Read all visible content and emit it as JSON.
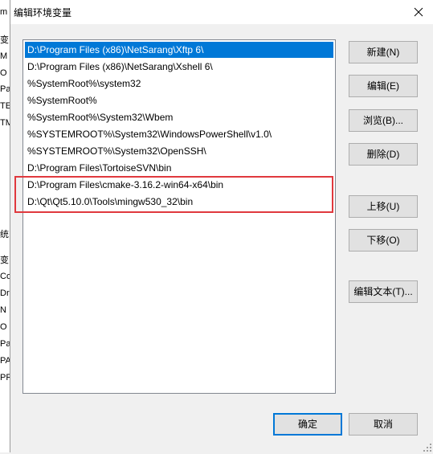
{
  "background_window": {
    "edge_chars": [
      "m",
      "变",
      "M",
      "O",
      "Pa",
      "TE",
      "TM",
      "统",
      "变",
      "Co",
      "Dr",
      "N",
      "O",
      "Pa",
      "PA",
      "PR"
    ]
  },
  "dialog": {
    "title": "编辑环境变量",
    "close_icon": "close-icon"
  },
  "list": {
    "items": [
      "D:\\Program Files (x86)\\NetSarang\\Xftp 6\\",
      "D:\\Program Files (x86)\\NetSarang\\Xshell 6\\",
      "%SystemRoot%\\system32",
      "%SystemRoot%",
      "%SystemRoot%\\System32\\Wbem",
      "%SYSTEMROOT%\\System32\\WindowsPowerShell\\v1.0\\",
      "%SYSTEMROOT%\\System32\\OpenSSH\\",
      "D:\\Program Files\\TortoiseSVN\\bin",
      "D:\\Program Files\\cmake-3.16.2-win64-x64\\bin",
      "D:\\Qt\\Qt5.10.0\\Tools\\mingw530_32\\bin"
    ],
    "selected_index": 0
  },
  "buttons": {
    "new": "新建(N)",
    "edit": "编辑(E)",
    "browse": "浏览(B)...",
    "delete": "删除(D)",
    "move_up": "上移(U)",
    "move_down": "下移(O)",
    "edit_text": "编辑文本(T)...",
    "ok": "确定",
    "cancel": "取消"
  },
  "colors": {
    "selection": "#0078d7",
    "highlight_frame": "#e0393e",
    "default_button_border": "#0078d7"
  }
}
